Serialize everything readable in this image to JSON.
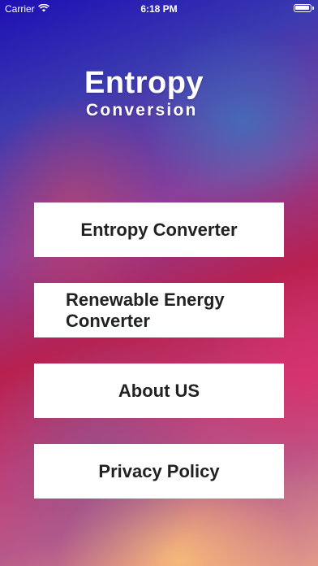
{
  "status_bar": {
    "carrier": "Carrier",
    "wifi_icon": "wifi-icon",
    "time": "6:18 PM",
    "battery_icon": "battery-full-icon"
  },
  "logo": {
    "title": "Entropy",
    "subtitle": "Conversion"
  },
  "menu": {
    "entropy_converter": "Entropy Converter",
    "renewable_energy_converter": "Renewable Energy Converter",
    "about_us": "About US",
    "privacy_policy": "Privacy Policy"
  },
  "colors": {
    "button_background": "#ffffff",
    "button_text": "#222222",
    "logo_text": "#ffffff"
  }
}
